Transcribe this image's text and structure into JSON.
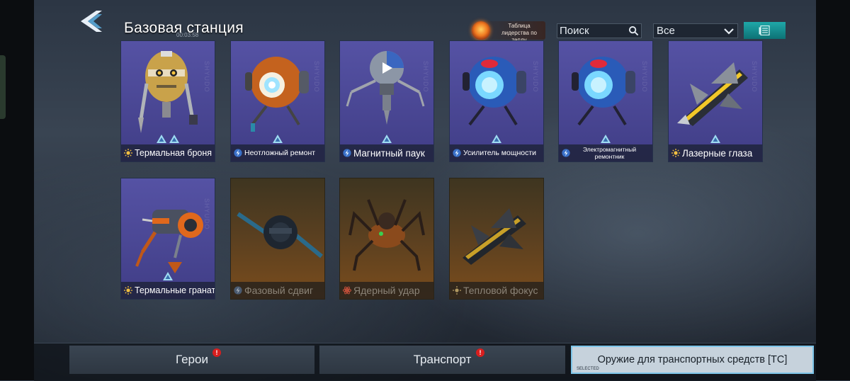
{
  "header": {
    "title": "Базовая станция",
    "timer": "00:03:58",
    "leaderboard_label": "Таблица лидерства по теплу",
    "search_placeholder": "Поиск",
    "filter_value": "Все"
  },
  "colors": {
    "owned_card": "#4f4c9c",
    "locked_card": "#6b461e",
    "accent_teal": "#1fa7a8",
    "selected_tab": "#c6d2dc",
    "badge_red": "#d81e1e"
  },
  "cards": [
    {
      "name": "Термальная броня",
      "type_icon": "sun-icon",
      "ranks": 2,
      "owned": true,
      "watermark": "SHYUDO"
    },
    {
      "name": "Неотложный ремонт",
      "type_icon": "bolt-icon",
      "ranks": 1,
      "owned": true,
      "watermark": "SHYUDO"
    },
    {
      "name": "Магнитный паук",
      "type_icon": "bolt-icon",
      "ranks": 1,
      "owned": true,
      "watermark": "SHYUDO"
    },
    {
      "name": "Усилитель мощности",
      "type_icon": "bolt-icon",
      "ranks": 1,
      "owned": true,
      "watermark": "SHYUDO"
    },
    {
      "name": "Электромагнитный ремонтник",
      "type_icon": "bolt-icon",
      "ranks": 1,
      "owned": true,
      "watermark": "SHYUDO"
    },
    {
      "name": "Лазерные глаза",
      "type_icon": "sun-icon",
      "ranks": 1,
      "owned": true,
      "watermark": "SHYUDO"
    },
    {
      "name": "Термальные гранаты",
      "type_icon": "sun-icon",
      "ranks": 1,
      "owned": true,
      "watermark": "SHYUDO"
    },
    {
      "name": "Фазовый сдвиг",
      "type_icon": "bolt-icon",
      "ranks": 0,
      "owned": false
    },
    {
      "name": "Ядерный удар",
      "type_icon": "atom-icon",
      "ranks": 0,
      "owned": false
    },
    {
      "name": "Тепловой фокус",
      "type_icon": "sun-icon",
      "ranks": 0,
      "owned": false
    }
  ],
  "tabs": [
    {
      "label": "Герои",
      "badge": "!"
    },
    {
      "label": "Транспорт",
      "badge": "!"
    },
    {
      "label": "Оружие для транспортных средств [ТС]",
      "tag": "SELECTED"
    }
  ]
}
